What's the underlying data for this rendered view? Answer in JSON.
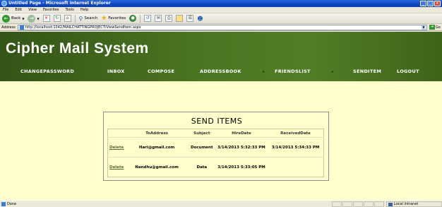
{
  "window": {
    "title": "Untitled Page - Microsoft Internet Explorer",
    "buttons": [
      "_",
      "□",
      "×"
    ]
  },
  "menubar": [
    "File",
    "Edit",
    "View",
    "Favorites",
    "Tools",
    "Help"
  ],
  "toolbar": {
    "back_label": "Back",
    "search_label": "Search",
    "favorites_label": "Favorites"
  },
  "address": {
    "label": "Address",
    "url": "http://localhost:1042/MAILCHATTINGPROJECT/ViewSendItem.aspx",
    "go_label": "Go"
  },
  "site": {
    "title": "Cipher Mail System",
    "nav": [
      "CHANGEPASSWORD",
      "INBOX",
      "COMPOSE",
      "ADDRESSBOOK",
      "FRIENDSLIST",
      "SENDITEM",
      "LOGOUT"
    ]
  },
  "send_items": {
    "title": "SEND ITEMS",
    "columns": [
      "",
      "ToAddress",
      "Subject",
      "HireDate",
      "ReceivedDate"
    ],
    "rows": [
      {
        "action": "Delete",
        "to": "Hari@gmail.com",
        "subject": "Document",
        "hire_date": "3/14/2013 5:32:33 PM",
        "received_date": "3/14/2013 5:34:33 PM"
      },
      {
        "action": "Delete",
        "to": "Nandhu@gmail.com",
        "subject": "Data",
        "hire_date": "3/14/2013 5:33:05 PM",
        "received_date": ""
      }
    ]
  },
  "statusbar": {
    "text": "Done",
    "zone": "Local intranet"
  },
  "colors": {
    "header_green": "#4b7521",
    "page_background": "#ffffcc",
    "nav_text": "#ffffff",
    "delete_link": "#556b2f"
  }
}
